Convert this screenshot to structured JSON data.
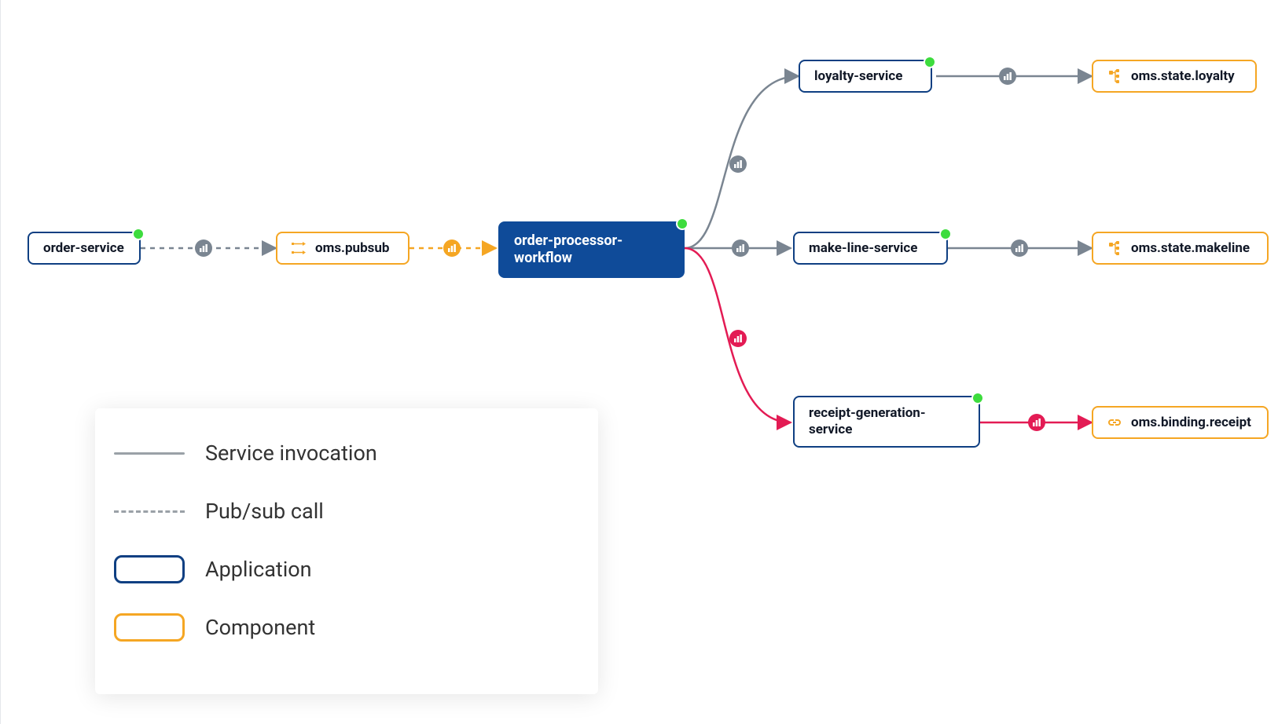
{
  "nodes": {
    "order_service": "order-service",
    "oms_pubsub": "oms.pubsub",
    "order_processor_workflow": "order-processor-workflow",
    "loyalty_service": "loyalty-service",
    "make_line_service": "make-line-service",
    "receipt_generation_service": "receipt-generation-service",
    "oms_state_loyalty": "oms.state.loyalty",
    "oms_state_makeline": "oms.state.makeline",
    "oms_binding_receipt": "oms.binding.receipt"
  },
  "legend": {
    "service_invocation": "Service invocation",
    "pubsub_call": "Pub/sub call",
    "application": "Application",
    "component": "Component"
  },
  "colors": {
    "app_border": "#0f3f82",
    "app_active_bg": "#0f4b99",
    "comp_border": "#f5a623",
    "status_green": "#3ddc3d",
    "edge_gray": "#7a8591",
    "edge_amber": "#f5a623",
    "edge_red": "#e31b54"
  },
  "edges": [
    {
      "from": "order_service",
      "to": "oms_pubsub",
      "style": "dashed",
      "color": "gray"
    },
    {
      "from": "oms_pubsub",
      "to": "order_processor_workflow",
      "style": "dashed",
      "color": "amber"
    },
    {
      "from": "order_processor_workflow",
      "to": "loyalty_service",
      "style": "solid",
      "color": "gray"
    },
    {
      "from": "order_processor_workflow",
      "to": "make_line_service",
      "style": "solid",
      "color": "gray"
    },
    {
      "from": "order_processor_workflow",
      "to": "receipt_generation_service",
      "style": "solid",
      "color": "red"
    },
    {
      "from": "loyalty_service",
      "to": "oms_state_loyalty",
      "style": "solid",
      "color": "gray"
    },
    {
      "from": "make_line_service",
      "to": "oms_state_makeline",
      "style": "solid",
      "color": "gray"
    },
    {
      "from": "receipt_generation_service",
      "to": "oms_binding_receipt",
      "style": "solid",
      "color": "red"
    }
  ]
}
